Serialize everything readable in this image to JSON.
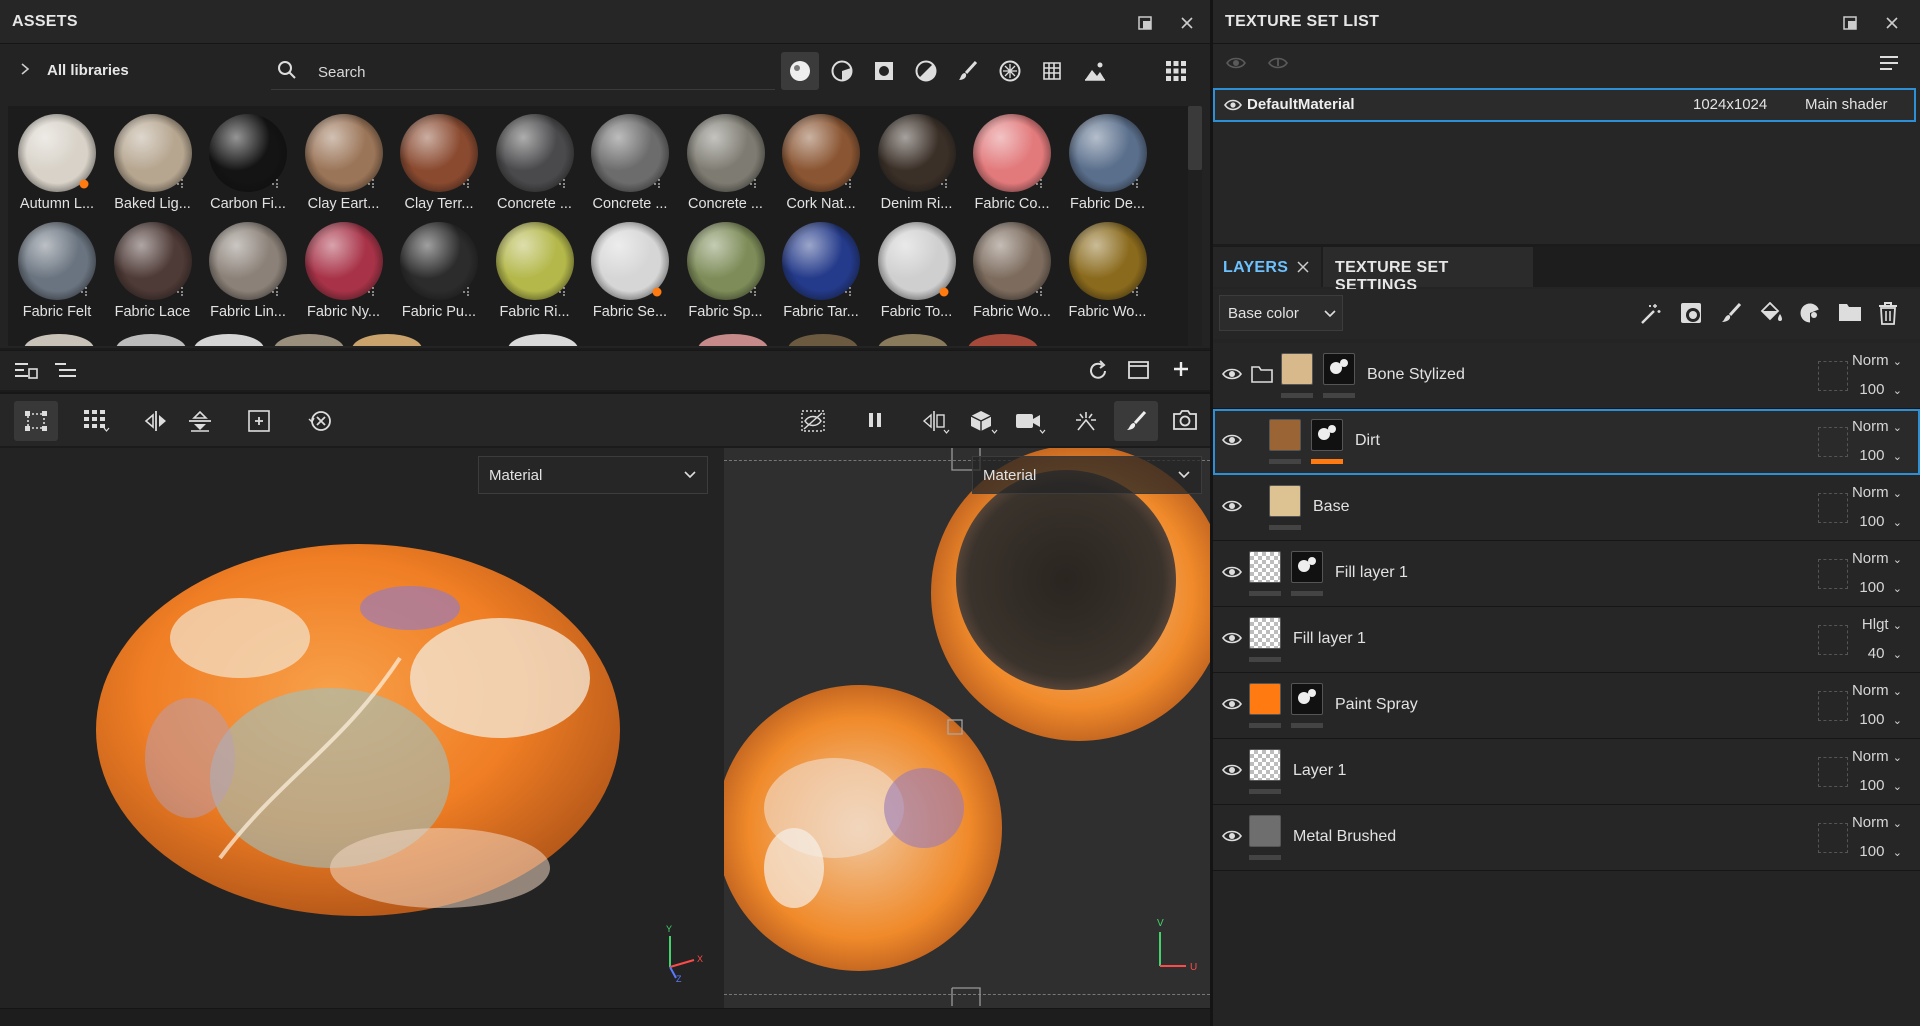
{
  "assets": {
    "title": "ASSETS",
    "libraries_label": "All libraries",
    "search_placeholder": "Search",
    "row1": [
      {
        "label": "Autumn L...",
        "color": "#d8d2c8",
        "badge": true
      },
      {
        "label": "Baked Lig...",
        "color": "#b6a690"
      },
      {
        "label": "Carbon Fi...",
        "color": "#141414"
      },
      {
        "label": "Clay Eart...",
        "color": "#9b7558"
      },
      {
        "label": "Clay Terr...",
        "color": "#8a4a30"
      },
      {
        "label": "Concrete ...",
        "color": "#4a4a4c"
      },
      {
        "label": "Concrete ...",
        "color": "#6c6c6c"
      },
      {
        "label": "Concrete ...",
        "color": "#7e7c72"
      },
      {
        "label": "Cork Nat...",
        "color": "#8a5532"
      },
      {
        "label": "Denim Ri...",
        "color": "#3b3028"
      },
      {
        "label": "Fabric Co...",
        "color": "#e27a7c"
      },
      {
        "label": "Fabric De...",
        "color": "#5a6f8c"
      }
    ],
    "row2": [
      {
        "label": "Fabric Felt",
        "color": "#6a7480"
      },
      {
        "label": "Fabric Lace",
        "color": "#4e3a36"
      },
      {
        "label": "Fabric Lin...",
        "color": "#8b8178"
      },
      {
        "label": "Fabric Ny...",
        "color": "#a83348"
      },
      {
        "label": "Fabric Pu...",
        "color": "#2c2c2c"
      },
      {
        "label": "Fabric Ri...",
        "color": "#b4b84a"
      },
      {
        "label": "Fabric Se...",
        "color": "#d6d6d6",
        "badge": true
      },
      {
        "label": "Fabric Sp...",
        "color": "#7d8c58"
      },
      {
        "label": "Fabric Tar...",
        "color": "#243a8a"
      },
      {
        "label": "Fabric To...",
        "color": "#cfcfcf",
        "badge": true
      },
      {
        "label": "Fabric Wo...",
        "color": "#7d6c5e"
      },
      {
        "label": "Fabric Wo...",
        "color": "#8a6a1c"
      }
    ]
  },
  "viewport": {
    "left_mode": "Material",
    "right_mode": "Material",
    "axes_3d": {
      "y": "Y",
      "x": "X",
      "z": "Z"
    },
    "axes_2d": {
      "v": "V",
      "u": "U"
    }
  },
  "texture_set_list": {
    "title": "TEXTURE SET LIST",
    "item": {
      "name": "DefaultMaterial",
      "resolution": "1024x1024",
      "shader": "Main shader"
    }
  },
  "layers_panel": {
    "tab_layers": "LAYERS",
    "tab_settings": "TEXTURE SET SETTINGS",
    "channel": "Base color",
    "layers": [
      {
        "name": "Bone Stylized",
        "blend": "Norm",
        "opacity": "100",
        "color": "#d7b98c",
        "folder": true
      },
      {
        "name": "Dirt",
        "blend": "Norm",
        "opacity": "100",
        "color": "#9b6434",
        "selected": true
      },
      {
        "name": "Base",
        "blend": "Norm",
        "opacity": "100",
        "color": "#dcc391"
      },
      {
        "name": "Fill layer 1",
        "blend": "Norm",
        "opacity": "100",
        "color": "checker"
      },
      {
        "name": "Fill layer 1",
        "blend": "Hlgt",
        "opacity": "40",
        "color": "checker"
      },
      {
        "name": "Paint Spray",
        "blend": "Norm",
        "opacity": "100",
        "color": "#ff7a10"
      },
      {
        "name": "Layer 1",
        "blend": "Norm",
        "opacity": "100",
        "color": "checker"
      },
      {
        "name": "Metal Brushed",
        "blend": "Norm",
        "opacity": "100",
        "color": "#6e6e6e"
      }
    ]
  },
  "colors": {
    "accent": "#2d8fd6",
    "orange": "#ff7a10"
  }
}
